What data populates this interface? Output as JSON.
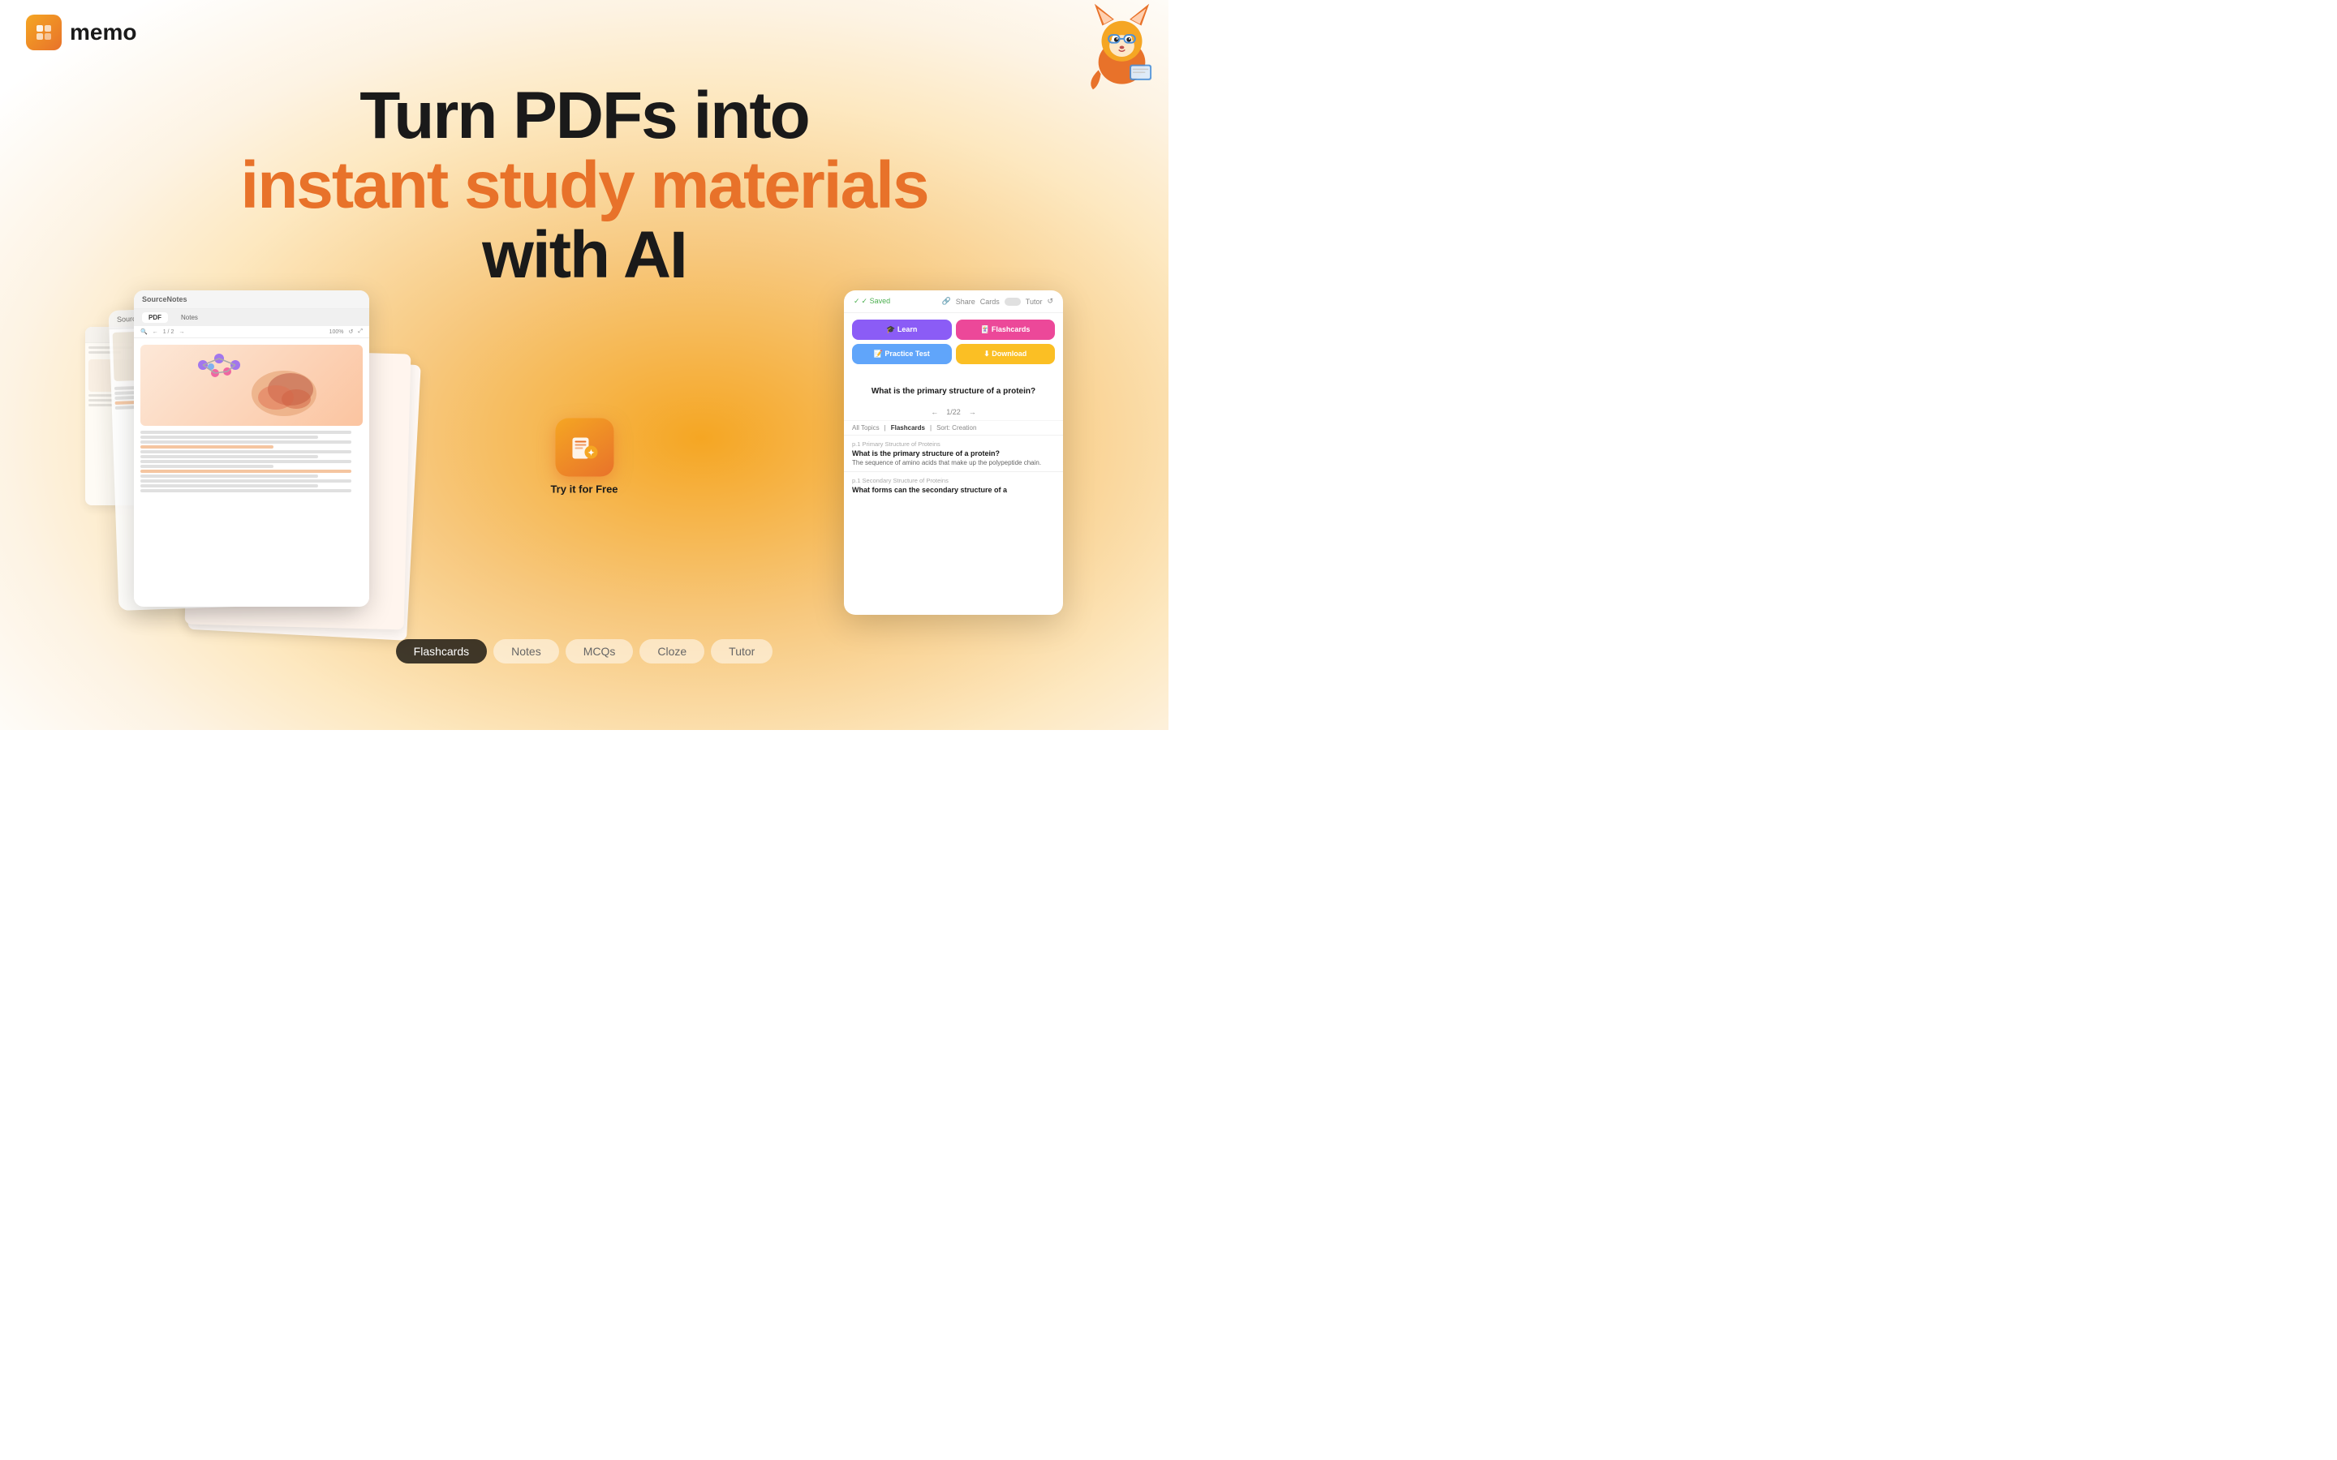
{
  "header": {
    "logo_text": "memo",
    "logo_icon": "✦"
  },
  "hero": {
    "line1": "Turn PDFs into",
    "line2": "instant study materials",
    "line3": "with AI"
  },
  "cta": {
    "label": "Try it for Free"
  },
  "ai_card": {
    "saved_label": "✓ Saved",
    "share_label": "Share",
    "cards_label": "Cards",
    "tutor_label": "Tutor",
    "buttons": {
      "learn": "🎓 Learn",
      "flashcards": "🃏 Flashcards",
      "practice_test": "📝 Practice Test",
      "download": "⬇ Download"
    },
    "question": "What is the primary structure of a protein?",
    "nav": "1/22",
    "tags": {
      "all_topics": "All Topics",
      "flashcards": "Flashcards",
      "sort": "Sort: Creation"
    },
    "flashcard1": {
      "page": "p.1",
      "topic": "Primary Structure of Proteins",
      "question": "What is the primary structure of a protein?",
      "answer": "The sequence of amino acids that make up the polypeptide chain."
    },
    "flashcard2": {
      "page": "p.1",
      "topic": "Secondary Structure of Proteins",
      "question": "What forms can the secondary structure of a"
    }
  },
  "pdf_card": {
    "title": "SourceNotes",
    "tab_pdf": "PDF",
    "tab_notes": "Notes",
    "page_info": "1 / 2"
  },
  "bottom_tabs": [
    {
      "label": "Flashcards",
      "active": true
    },
    {
      "label": "Notes",
      "active": false
    },
    {
      "label": "MCQs",
      "active": false
    },
    {
      "label": "Cloze",
      "active": false
    },
    {
      "label": "Tutor",
      "active": false
    }
  ]
}
